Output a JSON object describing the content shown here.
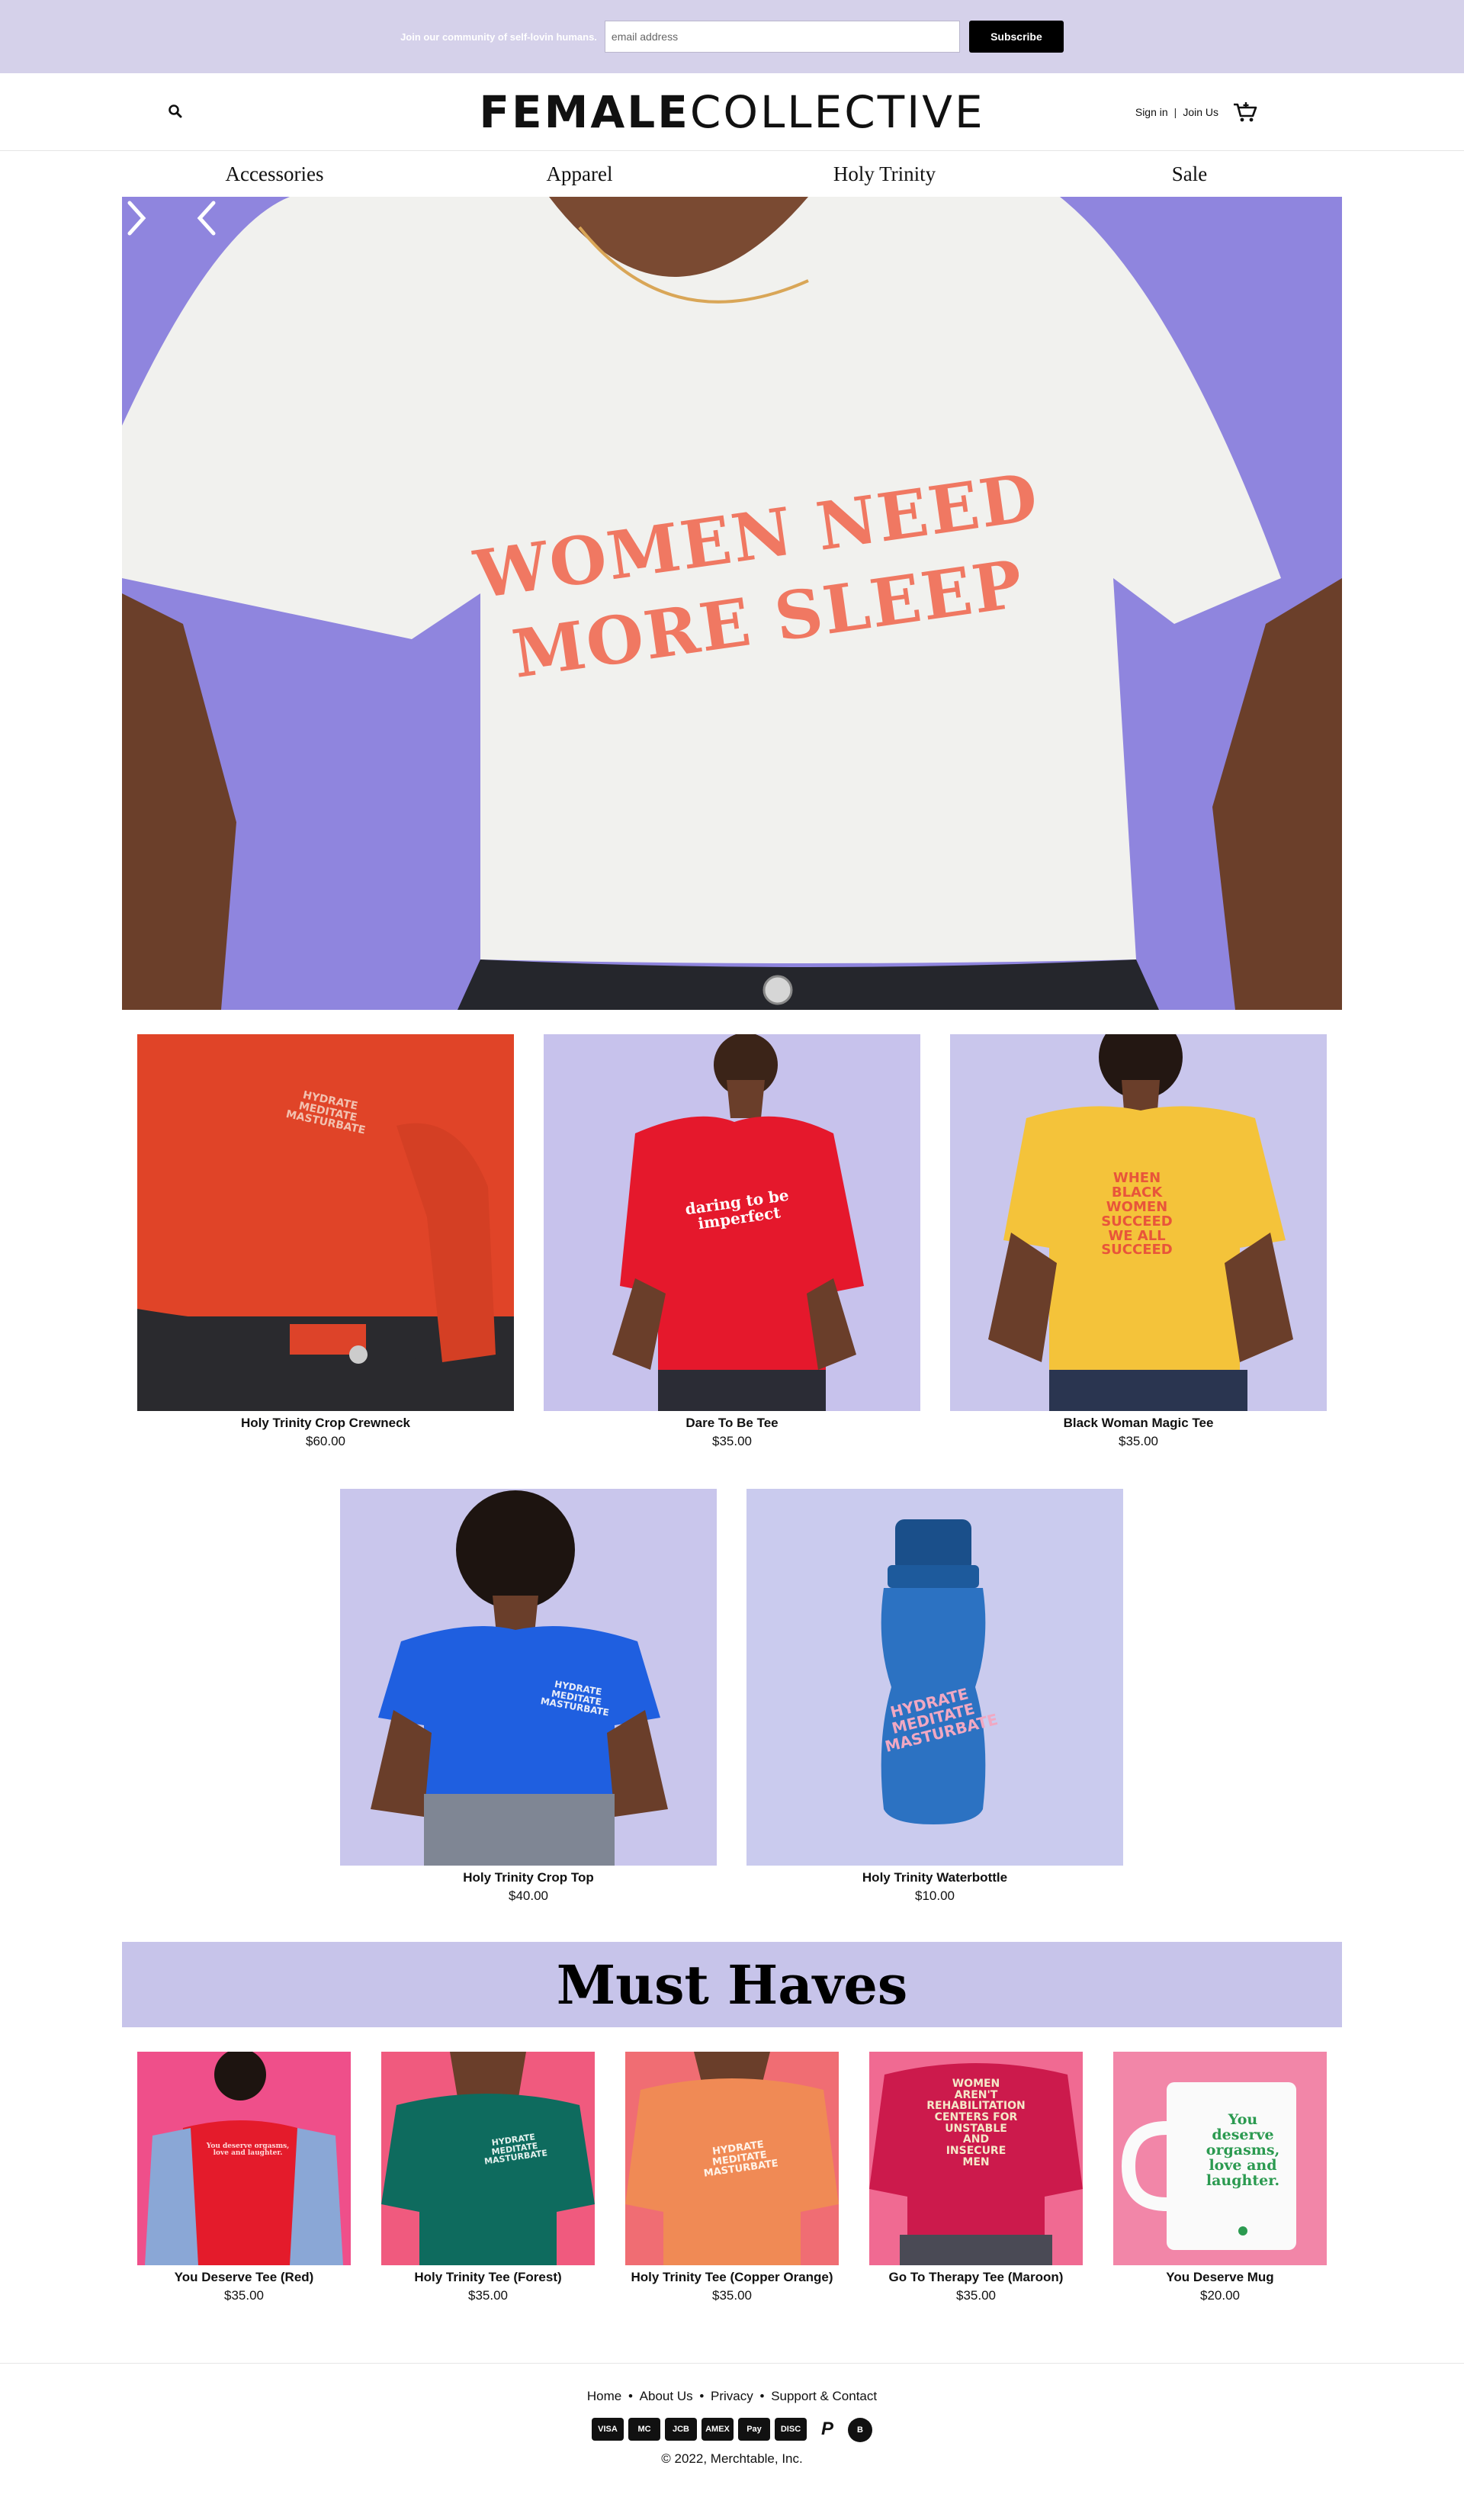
{
  "announce": {
    "text": "Join our community of self-lovin humans.",
    "email_placeholder": "email address",
    "subscribe_label": "Subscribe"
  },
  "header": {
    "logo_bold": "FEMALE",
    "logo_light": "COLLECTIVE",
    "sign_in": "Sign in",
    "separator": "|",
    "join_us": "Join Us",
    "search_icon": "search-icon",
    "cart_icon": "cart-icon"
  },
  "nav": {
    "items": [
      {
        "label": "Accessories"
      },
      {
        "label": "Apparel"
      },
      {
        "label": "Holy Trinity"
      },
      {
        "label": "Sale"
      }
    ]
  },
  "hero": {
    "shirt_line1": "WOMEN NEED",
    "shirt_line2": "MORE SLEEP",
    "prev_icon": "chevron-left-icon",
    "next_icon": "chevron-right-icon"
  },
  "featured": [
    {
      "name": "Holy Trinity Crop Crewneck",
      "price": "$60.00",
      "print": "HYDRATE\nMEDITATE\nMASTURBATE"
    },
    {
      "name": "Dare To Be Tee",
      "price": "$35.00",
      "print": "daring to be\nimperfect"
    },
    {
      "name": "Black Woman Magic Tee",
      "price": "$35.00",
      "print": "WHEN\nBLACK\nWOMEN\nSUCCEED\nWE ALL\nSUCCEED"
    },
    {
      "name": "Holy Trinity Crop Top",
      "price": "$40.00",
      "print": "HYDRATE\nMEDITATE\nMASTURBATE"
    },
    {
      "name": "Holy Trinity Waterbottle",
      "price": "$10.00",
      "print": "HYDRATE\nMEDITATE\nMASTURBATE"
    }
  ],
  "must_haves": {
    "title": "Must Haves",
    "items": [
      {
        "name": "You Deserve Tee (Red)",
        "price": "$35.00",
        "print": "You deserve orgasms,\nlove and laughter."
      },
      {
        "name": "Holy Trinity Tee (Forest)",
        "price": "$35.00",
        "print": "HYDRATE\nMEDITATE\nMASTURBATE"
      },
      {
        "name": "Holy Trinity Tee (Copper Orange)",
        "price": "$35.00",
        "print": "HYDRATE\nMEDITATE\nMASTURBATE"
      },
      {
        "name": "Go To Therapy Tee (Maroon)",
        "price": "$35.00",
        "print": "WOMEN\nAREN'T\nREHABILITATION\nCENTERS FOR\nUNSTABLE\nAND\nINSECURE\nMEN"
      },
      {
        "name": "You Deserve Mug",
        "price": "$20.00",
        "print": "You\ndeserve\norgasms,\nlove and\nlaughter."
      }
    ]
  },
  "footer": {
    "links": [
      "Home",
      "About Us",
      "Privacy",
      "Support & Contact"
    ],
    "dot": "•",
    "payments": [
      "VISA",
      "MC",
      "JCB",
      "AMEX",
      "Pay",
      "DISC",
      "P",
      "B"
    ],
    "copyright": "© 2022, Merchtable, Inc."
  },
  "colors": {
    "announce_bg": "#d5d1ea",
    "hero_bg": "#8f85de",
    "banner_bg": "#c7c4ea",
    "shirt_print": "#f07862"
  }
}
